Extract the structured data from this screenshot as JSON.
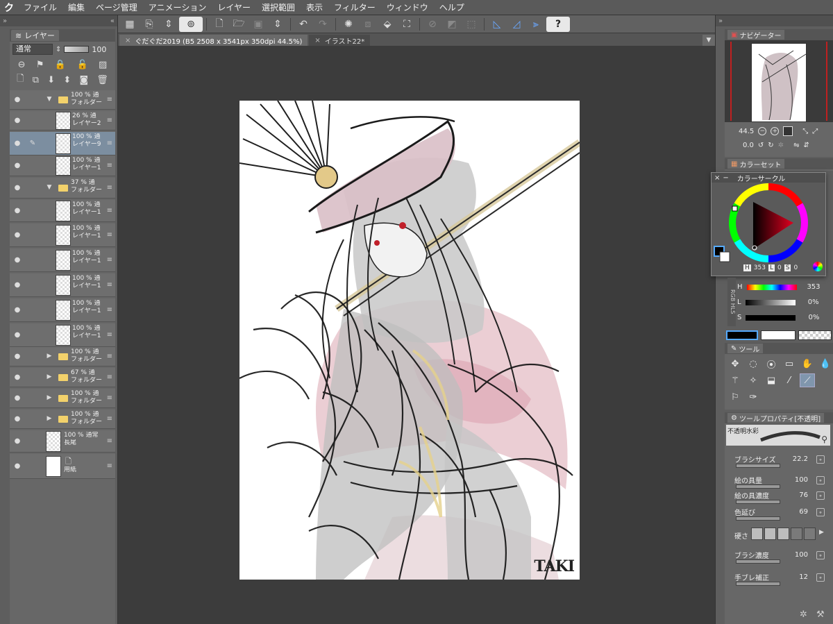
{
  "menu": [
    "ファイル",
    "編集",
    "ページ管理",
    "アニメーション",
    "レイヤー",
    "選択範囲",
    "表示",
    "フィルター",
    "ウィンドウ",
    "ヘルプ"
  ],
  "layer_panel": {
    "tab": "レイヤー",
    "blend": "通常",
    "opacity": "100",
    "layers": [
      {
        "line1": "100 % 通",
        "line2": "フォルダー",
        "type": "folder",
        "open": true
      },
      {
        "line1": "26 % 通",
        "line2": "レイヤー2",
        "type": "layer"
      },
      {
        "line1": "100 % 通",
        "line2": "レイヤー9",
        "type": "layer",
        "selected": true
      },
      {
        "line1": "100 % 通",
        "line2": "レイヤー1",
        "type": "layer"
      },
      {
        "line1": "37 % 通",
        "line2": "フォルダー",
        "type": "folder",
        "open": true
      },
      {
        "line1": "100 % 通",
        "line2": "レイヤー1",
        "type": "layer"
      },
      {
        "line1": "100 % 通",
        "line2": "レイヤー1",
        "type": "layer"
      },
      {
        "line1": "100 % 通",
        "line2": "レイヤー1",
        "type": "layer"
      },
      {
        "line1": "100 % 通",
        "line2": "レイヤー1",
        "type": "layer"
      },
      {
        "line1": "100 % 通",
        "line2": "レイヤー1",
        "type": "layer"
      },
      {
        "line1": "100 % 通",
        "line2": "レイヤー1",
        "type": "layer"
      },
      {
        "line1": "100 % 通",
        "line2": "フォルダー",
        "type": "folder",
        "open": false
      },
      {
        "line1": "67 % 通",
        "line2": "フォルダー",
        "type": "folder",
        "open": false
      },
      {
        "line1": "100 % 通",
        "line2": "フォルダー",
        "type": "folder",
        "open": false
      },
      {
        "line1": "100 % 通",
        "line2": "フォルダー",
        "type": "folder",
        "open": false
      },
      {
        "line1": "100 % 通常",
        "line2": "長尾",
        "type": "layer"
      },
      {
        "line1": "",
        "line2": "用紙",
        "type": "paper"
      }
    ]
  },
  "doc_tabs": [
    {
      "label": "ぐだぐだ2019 (B5 2508 x 3541px 350dpi 44.5%)",
      "active": true
    },
    {
      "label": "イラスト22*",
      "active": false
    }
  ],
  "navigator": {
    "tab": "ナビゲーター",
    "zoom": "44.5",
    "rotation": "0.0"
  },
  "colorset_tab": "カラーセット",
  "color_circle": {
    "title": "カラーサークル",
    "h": "353",
    "s": "0",
    "v": "0"
  },
  "hls": {
    "h": "353",
    "l": "0%",
    "s": "0%"
  },
  "tool_tab": "ツール",
  "tool_property": {
    "tab": "ツールプロパティ[不透明]",
    "brush_name": "不透明水彩",
    "props": [
      {
        "label": "ブラシサイズ",
        "value": "22.2"
      },
      {
        "label": "絵の具量",
        "value": "100"
      },
      {
        "label": "絵の具濃度",
        "value": "76"
      },
      {
        "label": "色延び",
        "value": "69"
      },
      {
        "label": "硬さ",
        "value": ""
      },
      {
        "label": "ブラシ濃度",
        "value": "100"
      },
      {
        "label": "手ブレ補正",
        "value": "12"
      }
    ]
  },
  "signature": "TAKI"
}
